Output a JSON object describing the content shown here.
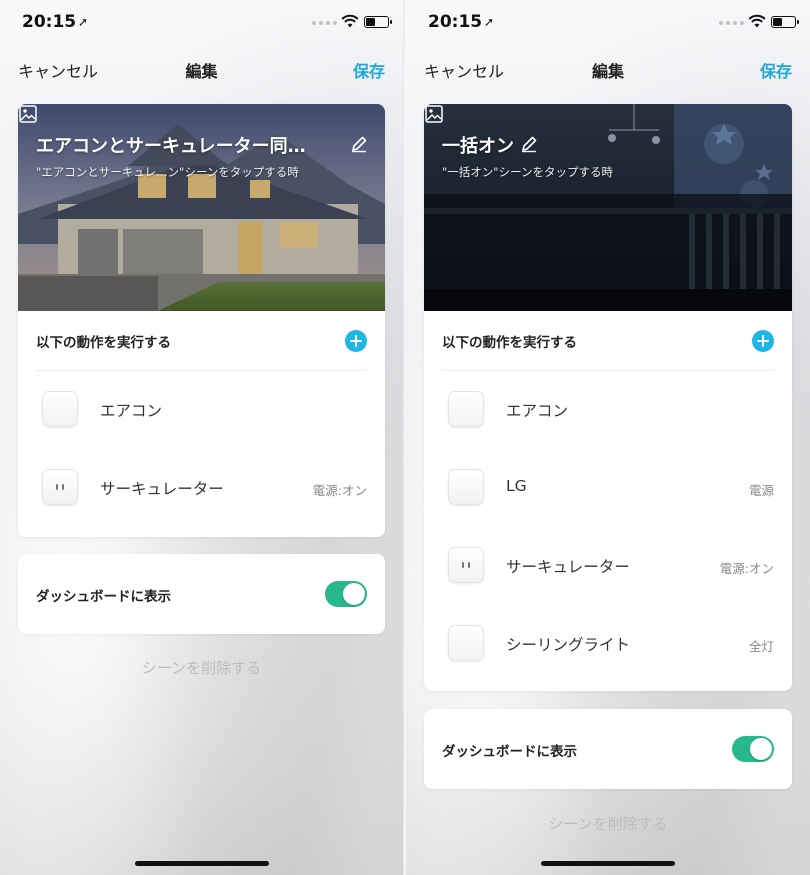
{
  "status": {
    "time": "20:15",
    "location_arrow": "➚"
  },
  "nav": {
    "cancel": "キャンセル",
    "title": "編集",
    "save": "保存"
  },
  "colors": {
    "accent": "#1ea7d6",
    "toggle_on": "#27b98c",
    "add_button": "#1eb6e6"
  },
  "left": {
    "scene_name": "エアコンとサーキュレーター同…",
    "trigger": "\"エアコンとサーキュレ…ン\"シーンをタップする時",
    "section_label": "以下の動作を実行する",
    "actions": [
      {
        "name": "エアコン",
        "state": "",
        "icon": "remote-icon"
      },
      {
        "name": "サーキュレーター",
        "state": "電源:オン",
        "icon": "plug-icon"
      }
    ],
    "dashboard_label": "ダッシュボードに表示",
    "dashboard_on": true,
    "delete_label": "シーンを削除する"
  },
  "right": {
    "scene_name": "一括オン",
    "trigger": "\"一括オン\"シーンをタップする時",
    "section_label": "以下の動作を実行する",
    "actions": [
      {
        "name": "エアコン",
        "state": "",
        "icon": "remote-icon"
      },
      {
        "name": "LG",
        "state": "電源",
        "icon": "remote-icon"
      },
      {
        "name": "サーキュレーター",
        "state": "電源:オン",
        "icon": "plug-icon"
      },
      {
        "name": "シーリングライト",
        "state": "全灯",
        "icon": "remote-icon"
      }
    ],
    "dashboard_label": "ダッシュボードに表示",
    "dashboard_on": true,
    "delete_label": "シーンを削除する"
  }
}
